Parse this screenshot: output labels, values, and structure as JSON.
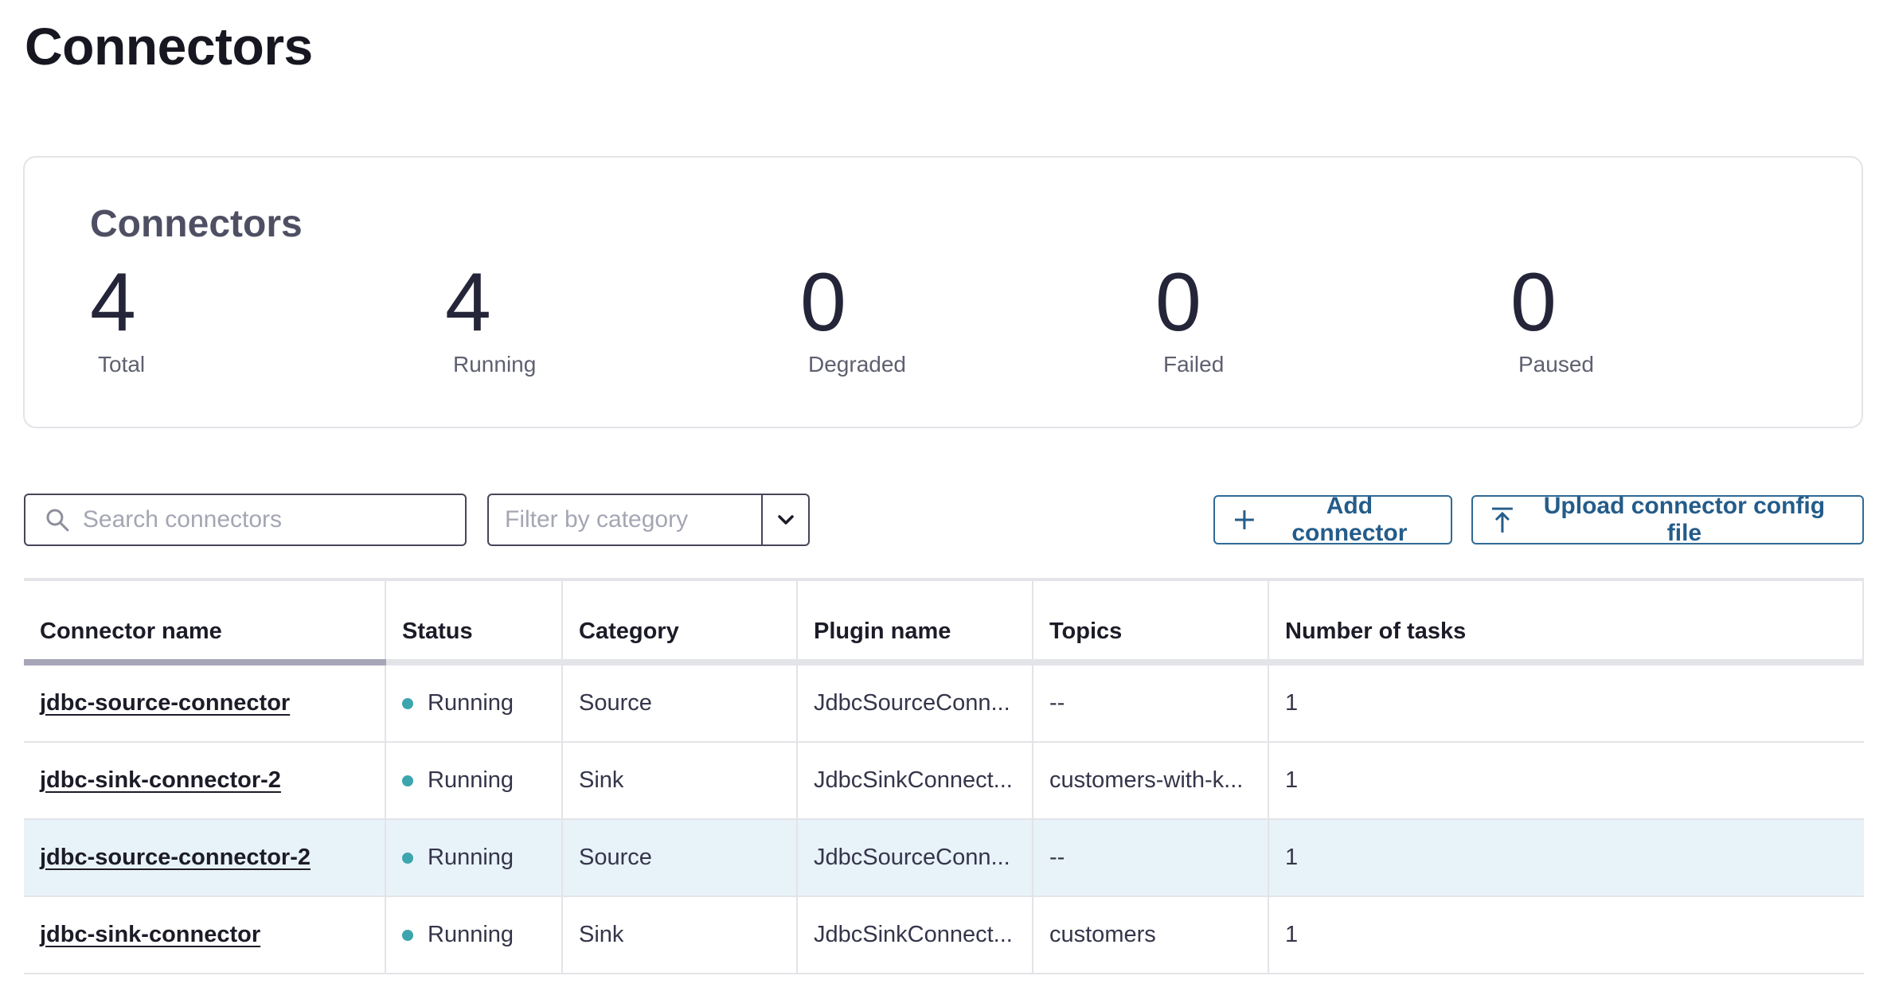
{
  "page": {
    "title": "Connectors"
  },
  "summary": {
    "title": "Connectors",
    "stats": [
      {
        "value": "4",
        "label": "Total"
      },
      {
        "value": "4",
        "label": "Running"
      },
      {
        "value": "0",
        "label": "Degraded"
      },
      {
        "value": "0",
        "label": "Failed"
      },
      {
        "value": "0",
        "label": "Paused"
      }
    ]
  },
  "toolbar": {
    "search_placeholder": "Search connectors",
    "filter_placeholder": "Filter by category",
    "add_label": "Add connector",
    "upload_label": "Upload connector config file"
  },
  "table": {
    "headers": [
      "Connector name",
      "Status",
      "Category",
      "Plugin name",
      "Topics",
      "Number of tasks"
    ],
    "rows": [
      {
        "name": "jdbc-source-connector",
        "status": "Running",
        "category": "Source",
        "plugin": "JdbcSourceConn...",
        "topics": "--",
        "tasks": "1"
      },
      {
        "name": "jdbc-sink-connector-2",
        "status": "Running",
        "category": "Sink",
        "plugin": "JdbcSinkConnect...",
        "topics": "customers-with-k...",
        "tasks": "1"
      },
      {
        "name": "jdbc-source-connector-2",
        "status": "Running",
        "category": "Source",
        "plugin": "JdbcSourceConn...",
        "topics": "--",
        "tasks": "1"
      },
      {
        "name": "jdbc-sink-connector",
        "status": "Running",
        "category": "Sink",
        "plugin": "JdbcSinkConnect...",
        "topics": "customers",
        "tasks": "1"
      }
    ]
  },
  "colors": {
    "accent": "#245c8a",
    "running_status": "#3ca5ad",
    "row_highlight": "#e8f2f9"
  }
}
